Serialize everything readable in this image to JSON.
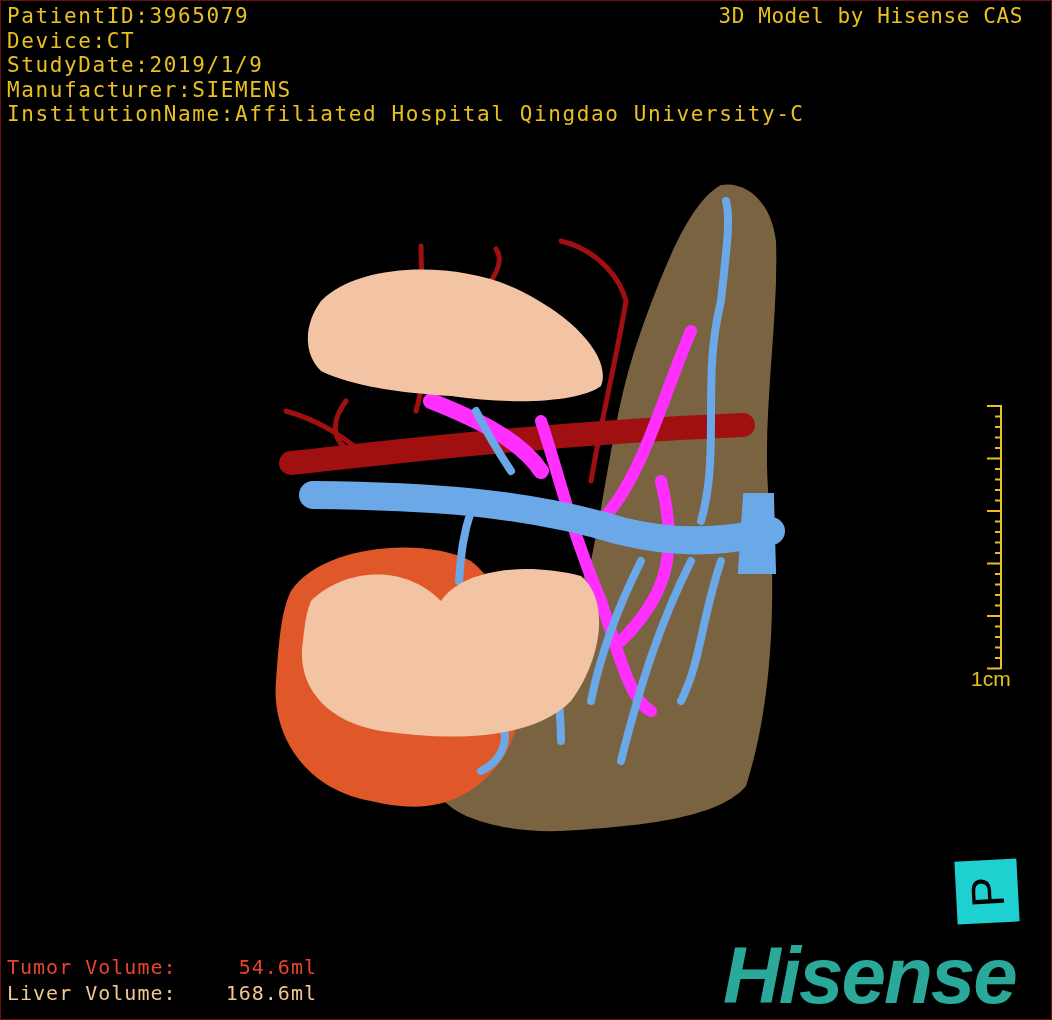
{
  "info_lines": [
    "PatientID:3965079",
    "Device:CT",
    "StudyDate:2019/1/9",
    "Manufacturer:SIEMENS",
    "InstitutionName:Affiliated Hospital Qingdao University-C"
  ],
  "model_credit": "3D Model by Hisense CAS",
  "scale_bar": {
    "label": "1cm"
  },
  "volumes": [
    {
      "label": "Tumor Volume:",
      "value": "54.6ml",
      "color": "#e8452c"
    },
    {
      "label": "Liver Volume:",
      "value": "168.6ml",
      "color": "#f0c890"
    }
  ],
  "orientation_cube": {
    "label": "P"
  },
  "logo": "Hisense"
}
